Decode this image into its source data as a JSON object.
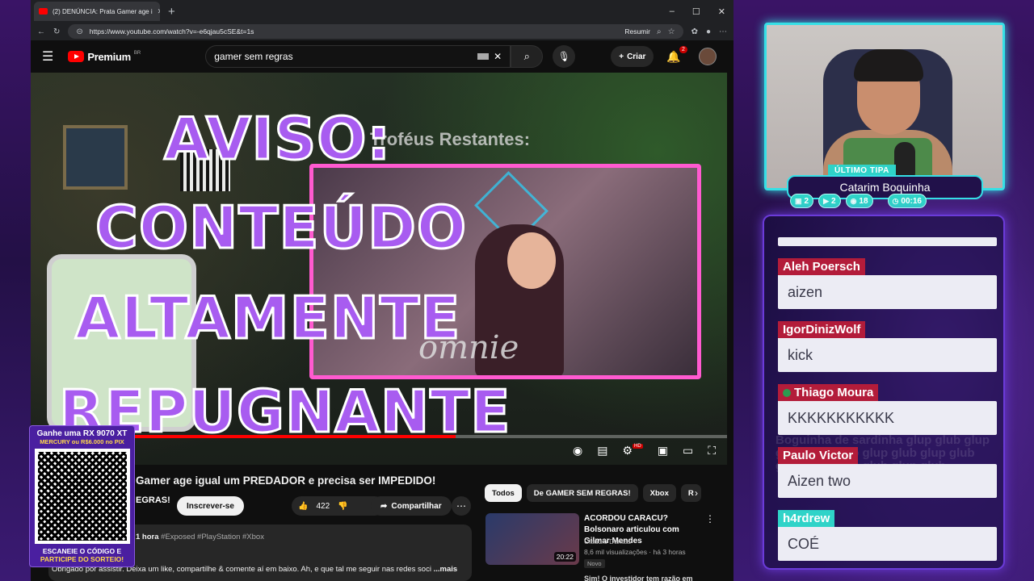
{
  "browser": {
    "tab_title": "(2) DENÚNCIA: Prata Gamer age i",
    "url": "https://www.youtube.com/watch?v=-e6qjau5cSE&t=1s",
    "resumir": "Resumir"
  },
  "youtube": {
    "brand": "Premium",
    "region": "BR",
    "search_value": "gamer sem regras",
    "create_label": "Criar",
    "notif_count": "2"
  },
  "video": {
    "hud_text": "Troféus Restantes:",
    "signature": "ömnie",
    "warning_lines": [
      "AVISO:",
      "CONTEÚDO",
      "ALTAMENTE",
      "REPUGNANTE"
    ],
    "progress": 0.61,
    "title": "Gamer age igual um PREDADOR e precisa ser IMPEDIDO!",
    "channel_fragment": "EGRAS!",
    "subscribe_label": "Inscrever-se",
    "likes": "422",
    "share_label": "Compartilhar",
    "desc_time": "1 hora",
    "desc_tags": "#Exposed #PlayStation #Xbox",
    "desc_text": "Obrigado por assistir. Deixa um like, compartilhe & comente aí em baixo. Ah, e que tal me seguir nas redes soci",
    "desc_more": "...mais"
  },
  "sidebar": {
    "chips": [
      "Todos",
      "De GAMER SEM REGRAS!",
      "Xbox",
      "R"
    ],
    "rec": {
      "title": "ACORDOU CARACU? Bolsonaro articulou com Gilmar Mendes",
      "channel": "Claudio Dantas",
      "meta": "8,6 mil visualizações · há 3 horas",
      "badge": "Novo",
      "duration": "20:22"
    },
    "rec2_title": "Sim! O investidor tem razão em"
  },
  "promo": {
    "line1": "Ganhe uma RX 9070 XT",
    "line2": "MERCURY ou R$6.000 no PIX",
    "cta1": "ESCANEIE O CÓDIGO E",
    "cta2": "PARTICIPE DO SORTEIO!"
  },
  "stream": {
    "tip_label": "ÚLTIMO TIPA",
    "tip_name": "Catarim Boquinha",
    "stats": [
      {
        "icon": "chat",
        "value": "2"
      },
      {
        "icon": "youtube",
        "value": "2"
      },
      {
        "icon": "viewers",
        "value": "18"
      },
      {
        "icon": "clock",
        "value": "00:16"
      }
    ],
    "chat_bg_text": "Boguinha de sardinha glup glub glup glub glup glub glup glub glup glub glup glub glup glub glup glub",
    "chat": [
      {
        "author": "Aleh Poersch",
        "text": "aizen"
      },
      {
        "author": "IgorDinizWolf",
        "text": "kick"
      },
      {
        "author": "Thiago Moura",
        "text": "KKKKKKKKKKK"
      },
      {
        "author": "Paulo Victor",
        "text": "Aizen two"
      },
      {
        "author": "h4rdrew",
        "text": "COÉ"
      }
    ]
  },
  "colors": {
    "accent_cyan": "#35e0e6",
    "chat_author": "#b31c3a",
    "h4rdrew_author": "#2fd3c8",
    "warning_purple": "#a85cf0"
  }
}
